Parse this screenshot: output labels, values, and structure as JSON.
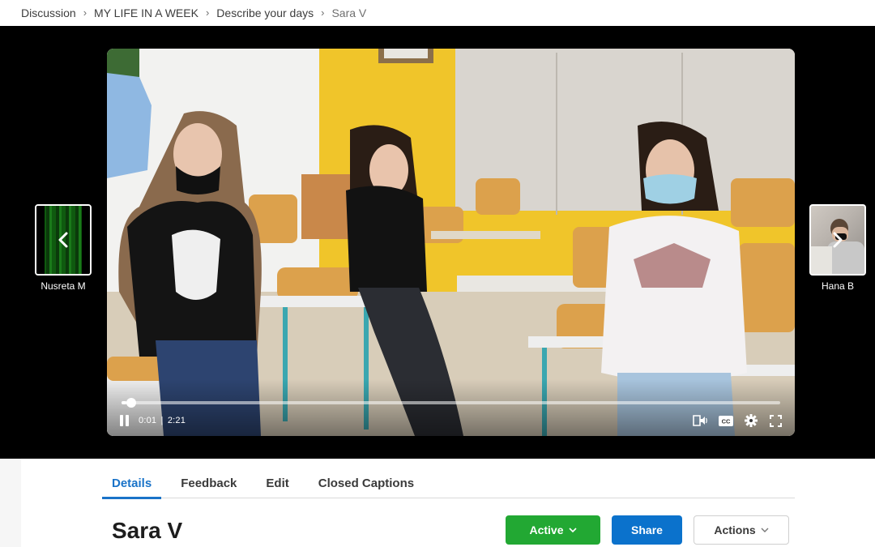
{
  "breadcrumb": {
    "items": [
      {
        "label": "Discussion"
      },
      {
        "label": "MY LIFE IN A WEEK"
      },
      {
        "label": "Describe your days"
      },
      {
        "label": "Sara V"
      }
    ],
    "separator": "›"
  },
  "player": {
    "current_time": "0:01",
    "duration": "2:21",
    "time_divider": "|",
    "progress_fraction": 0.007,
    "state": "playing",
    "controls": [
      "pause-icon",
      "audio-description-icon",
      "closed-captions-icon",
      "settings-gear-icon",
      "fullscreen-icon"
    ],
    "cc_label": "CC"
  },
  "nav": {
    "previous": {
      "name": "Nusreta M",
      "icon": "chevron-left-icon"
    },
    "next": {
      "name": "Hana B",
      "icon": "chevron-right-icon"
    }
  },
  "tabs": [
    {
      "label": "Details",
      "active": true
    },
    {
      "label": "Feedback",
      "active": false
    },
    {
      "label": "Edit",
      "active": false
    },
    {
      "label": "Closed Captions",
      "active": false
    }
  ],
  "response": {
    "title": "Sara V"
  },
  "buttons": {
    "active_label": "Active",
    "share_label": "Share",
    "actions_label": "Actions"
  },
  "colors": {
    "accent_blue": "#1a73c8",
    "active_green": "#22a833",
    "share_blue": "#0b72cc"
  }
}
